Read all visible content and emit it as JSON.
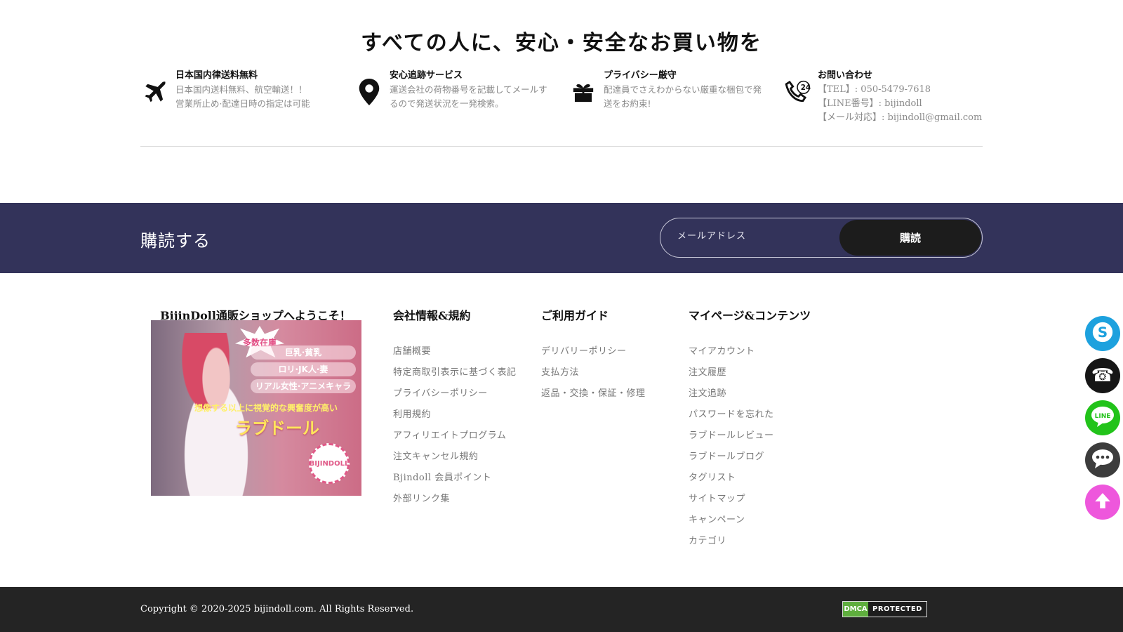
{
  "features": {
    "title": "すべての人に、安心・安全なお買い物を",
    "items": [
      {
        "icon": "airplane-icon",
        "title": "日本国内律送料無料",
        "lines": [
          "日本国内送料無料、航空輸送！！",
          "営業所止め·配達日時の指定は可能"
        ]
      },
      {
        "icon": "location-pin-icon",
        "title": "安心追跡サービス",
        "lines": [
          "運送会社の荷物番号を記載してメールす",
          "るので発送状況を一発検索。"
        ]
      },
      {
        "icon": "gift-icon",
        "title": "プライバシー厳守",
        "lines": [
          "配達員でさえわからない厳重な梱包で発",
          "送をお約束!"
        ]
      },
      {
        "icon": "phone-24h-icon",
        "title": "お問い合わせ",
        "lines": [
          "【TEL】: 050-5479-7618",
          "【LINE番号】: bijindoll",
          "【メール対応】: bijindoll@gmail.com"
        ]
      }
    ]
  },
  "subscribe": {
    "label": "購読する",
    "placeholder": "メールアドレス",
    "button": "購読"
  },
  "welcome": {
    "title": "BijinDoll通販ショップへようこそ！",
    "banner": {
      "burst": "多数在庫",
      "tags": [
        "巨乳·貧乳",
        "ロリ·JK人·妻",
        "リアル女性·アニメキャラ"
      ],
      "tagline": "想像する以上に視覚的な興奮度が高い",
      "headline": "ラブドール",
      "logo": "BIJINDOLL"
    }
  },
  "columns": [
    {
      "title": "会社情報&規約",
      "items": [
        "店舗概要",
        "特定商取引表示に基づく表記",
        "プライバシーポリシー",
        "利用規約",
        "アフィリエイトプログラム",
        "注文キャンセル規約",
        "Bjindoll 会員ポイント",
        "外部リンク集"
      ]
    },
    {
      "title": "ご利用ガイド",
      "items": [
        "デリバリーポリシー",
        "支払方法",
        "返品・交換・保証・修理"
      ]
    },
    {
      "title": "マイページ&コンテンツ",
      "items": [
        "マイアカウント",
        "注文履歴",
        "注文追跡",
        "パスワードを忘れた",
        "ラブドールレビュー",
        "ラブドールブログ",
        "タグリスト",
        "サイトマップ",
        "キャンペーン",
        "カテゴリ"
      ]
    }
  ],
  "float_buttons": [
    {
      "name": "skype-button",
      "icon": "skype-icon",
      "color": "#1da1de",
      "label": "S"
    },
    {
      "name": "phone-button",
      "icon": "phone-icon",
      "color": "#161616",
      "label": "☎"
    },
    {
      "name": "line-button",
      "icon": "line-icon",
      "color": "#22c31a",
      "label": "LINE"
    },
    {
      "name": "chat-button",
      "icon": "chat-icon",
      "color": "#3c3c3c",
      "label": ""
    },
    {
      "name": "back-to-top-button",
      "icon": "arrow-up-icon",
      "color": "#ee57dc",
      "label": ""
    }
  ],
  "footer": {
    "copyright": "Copyright © 2020-2025 bijindoll.com. All Rights Reserved.",
    "dmca_left": "DMCA",
    "dmca_right": "PROTECTED"
  }
}
